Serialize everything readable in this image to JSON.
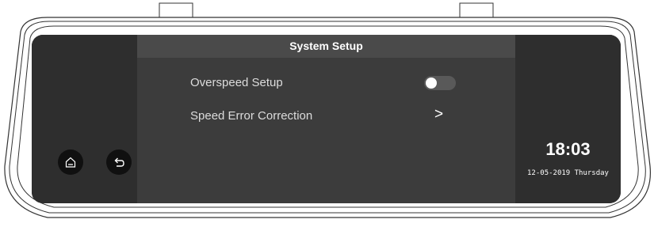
{
  "screen": {
    "title": "System Setup",
    "items": [
      {
        "label": "Overspeed Setup",
        "control": "toggle",
        "state": "off"
      },
      {
        "label": "Speed Error Correction",
        "control": "chevron",
        "glyph": ">"
      }
    ]
  },
  "left_panel": {
    "buttons": [
      {
        "icon": "home-icon"
      },
      {
        "icon": "back-icon"
      }
    ]
  },
  "status": {
    "time": "18:03",
    "date": "12-05-2019 Thursday"
  },
  "colors": {
    "screen_bg": "#262626",
    "side_panel_bg": "#2e2e2e",
    "center_bg": "#3c3c3c",
    "title_bar_bg": "#4a4a4a",
    "toggle_track": "#595959",
    "text": "#ffffff"
  }
}
